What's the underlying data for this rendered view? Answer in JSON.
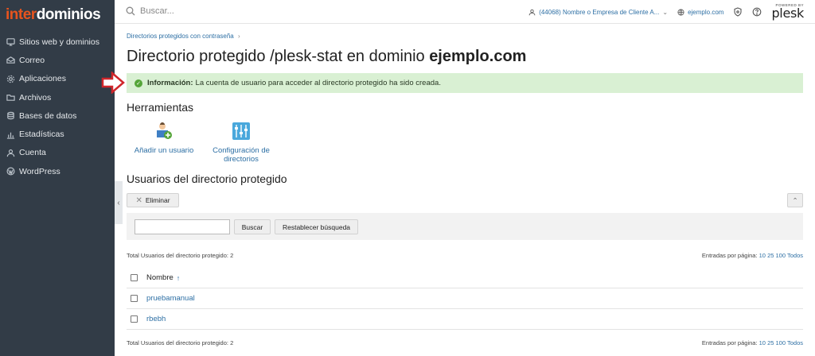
{
  "brand": {
    "logo_part1": "inter",
    "logo_part2": "dominios"
  },
  "sidebar": {
    "items": [
      {
        "label": "Sitios web y dominios",
        "icon": "monitor-icon"
      },
      {
        "label": "Correo",
        "icon": "mail-icon"
      },
      {
        "label": "Aplicaciones",
        "icon": "gear-icon"
      },
      {
        "label": "Archivos",
        "icon": "folder-icon"
      },
      {
        "label": "Bases de datos",
        "icon": "database-icon"
      },
      {
        "label": "Estadísticas",
        "icon": "bar-chart-icon"
      },
      {
        "label": "Cuenta",
        "icon": "user-icon"
      },
      {
        "label": "WordPress",
        "icon": "wordpress-icon"
      }
    ]
  },
  "topbar": {
    "search_placeholder": "Buscar...",
    "account_label": "(44068) Nombre o Empresa de Cliente A...",
    "domain_label": "ejemplo.com",
    "powered_by": "POWERED BY",
    "plesk": "plesk"
  },
  "breadcrumb": {
    "item": "Directorios protegidos con contraseña",
    "sep": "›"
  },
  "title": {
    "prefix": "Directorio protegido /plesk-stat en dominio ",
    "domain": "ejemplo.com"
  },
  "message": {
    "label": "Información:",
    "text": "La cuenta de usuario para acceder al directorio protegido ha sido creada."
  },
  "tools": {
    "title": "Herramientas",
    "add_user": "Añadir un usuario",
    "config_line1": "Configuración de",
    "config_line2": "directorios"
  },
  "users": {
    "title": "Usuarios del directorio protegido",
    "delete_label": "Eliminar",
    "search_button": "Buscar",
    "reset_button": "Restablecer búsqueda",
    "total_text": "Total Usuarios del directorio protegido: 2",
    "perpage_label": "Entradas por página:",
    "perpage_options": [
      "10",
      "25",
      "100",
      "Todos"
    ],
    "column_name": "Nombre",
    "sort_indicator": "↑",
    "rows": [
      "pruebamanual",
      "rbebh"
    ]
  },
  "colors": {
    "sidebar_bg": "#323c47",
    "brand_orange": "#e8541e",
    "link_blue": "#2d6fa4",
    "success_bg": "#d9f0d3",
    "arrow_red": "#d0262b"
  }
}
